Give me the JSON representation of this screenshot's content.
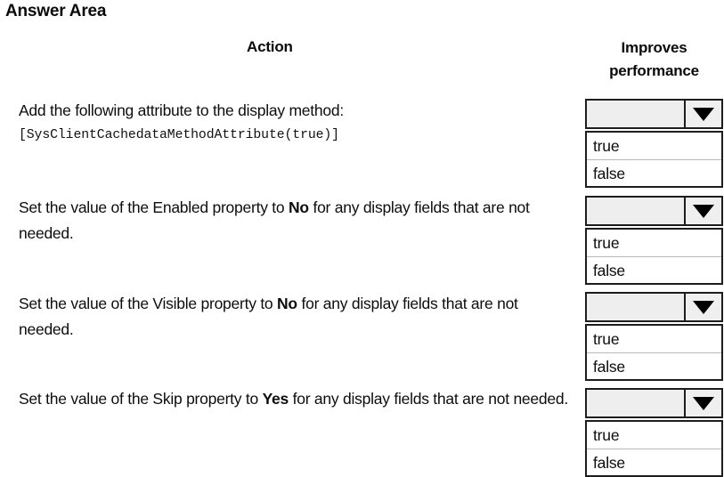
{
  "page": {
    "title": "Answer Area"
  },
  "headers": {
    "action": "Action",
    "improves_line1": "Improves",
    "improves_line2": "performance"
  },
  "rows": [
    {
      "text_before": "Add the following attribute to the display method:",
      "bold": "",
      "text_after": "",
      "code": "[SysClientCachedataMethodAttribute(true)]",
      "dropdown": {
        "value": "",
        "arrow_icon": "chevron-down-icon",
        "options": [
          "true",
          "false"
        ]
      }
    },
    {
      "text_before": "Set the value of the Enabled property to ",
      "bold": "No",
      "text_after": " for any display fields that are not needed.",
      "code": "",
      "dropdown": {
        "value": "",
        "arrow_icon": "chevron-down-icon",
        "options": [
          "true",
          "false"
        ]
      }
    },
    {
      "text_before": "Set the value of the Visible property to ",
      "bold": "No",
      "text_after": " for any display fields that are not needed.",
      "code": "",
      "dropdown": {
        "value": "",
        "arrow_icon": "chevron-down-icon",
        "options": [
          "true",
          "false"
        ]
      }
    },
    {
      "text_before": "Set the value of the Skip property to ",
      "bold": "Yes",
      "text_after": " for any display fields that are not needed.",
      "code": "",
      "dropdown": {
        "value": "",
        "arrow_icon": "chevron-down-icon",
        "options": [
          "true",
          "false"
        ]
      }
    }
  ],
  "colors": {
    "background": "#ffffff",
    "text": "#0d0d0d",
    "border": "#1d1d1d",
    "combobox_fill": "#eeeeee",
    "option_fill": "#ffffff",
    "option_divider": "#b9b9b9"
  }
}
